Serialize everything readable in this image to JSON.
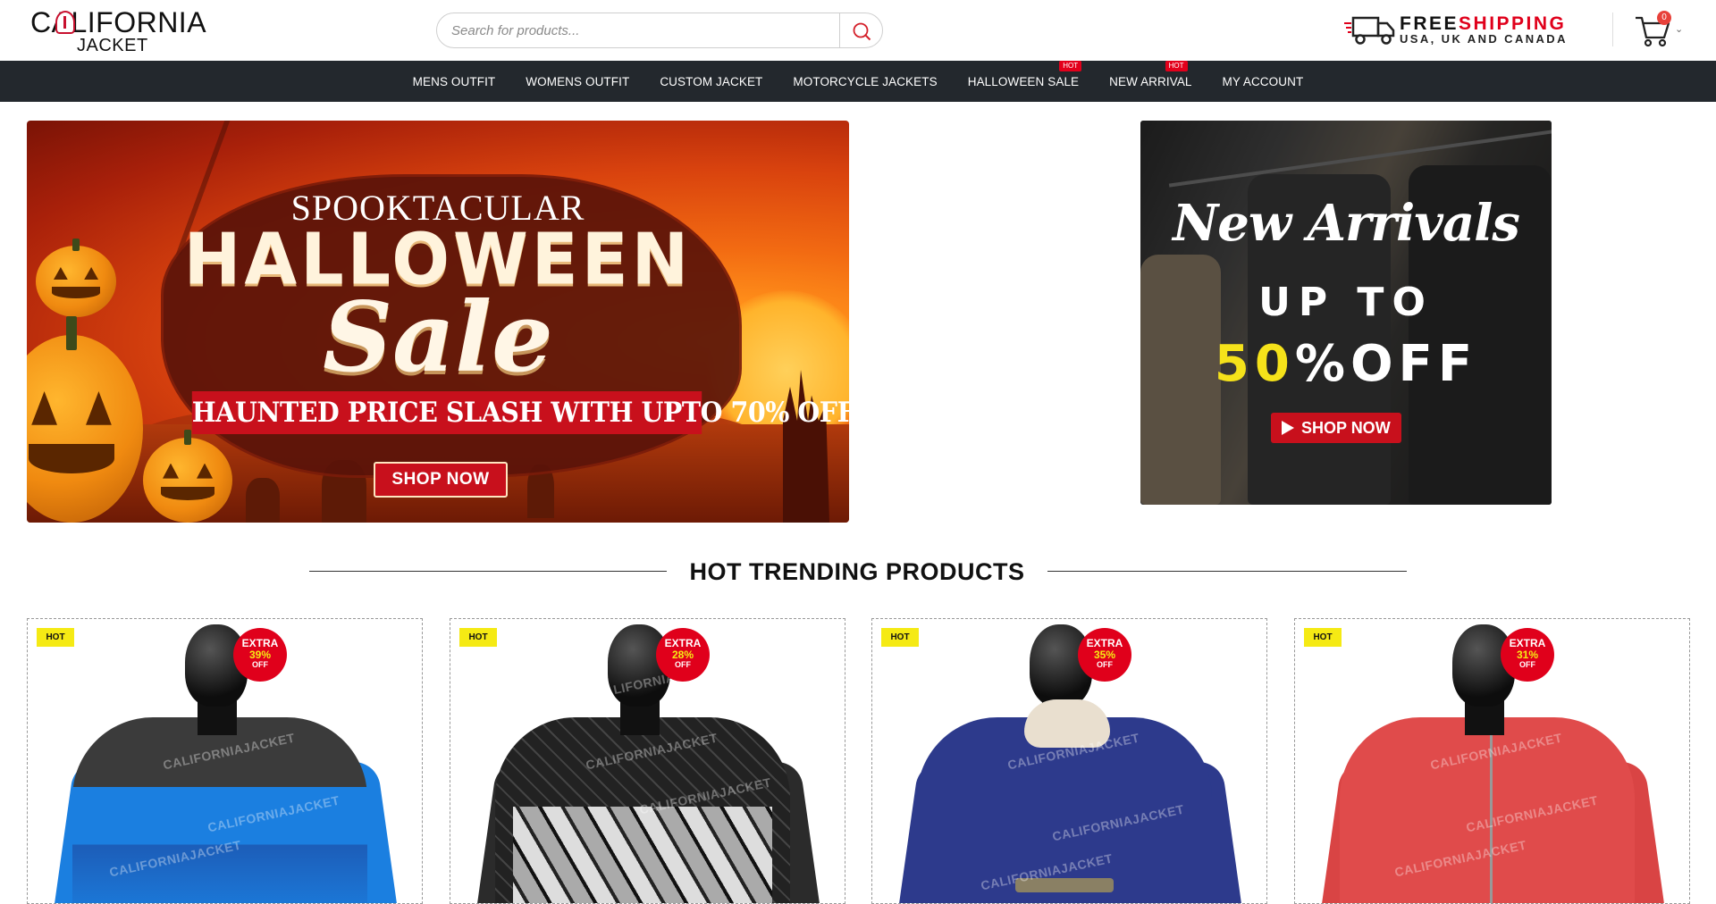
{
  "brand": {
    "logo_line1": "CALIFORNIA",
    "logo_line2": "JACKET",
    "logo_icon": "jacket-icon"
  },
  "search": {
    "placeholder": "Search for products...",
    "value": "",
    "icon": "search-icon"
  },
  "shipping": {
    "free": "FREE",
    "shipping": "SHIPPING",
    "regions": "USA, UK AND CANADA",
    "icon": "truck-icon"
  },
  "cart": {
    "count": "0",
    "icon": "cart-icon"
  },
  "nav": {
    "items": [
      {
        "label": "MENS OUTFIT"
      },
      {
        "label": "WOMENS OUTFIT"
      },
      {
        "label": "CUSTOM JACKET"
      },
      {
        "label": "MOTORCYCLE JACKETS"
      },
      {
        "label": "HALLOWEEN SALE",
        "badge": "HOT"
      },
      {
        "label": "NEW ARRIVAL",
        "badge": "HOT"
      },
      {
        "label": "MY ACCOUNT"
      }
    ]
  },
  "banner_halloween": {
    "line1": "SPOOKTACULAR",
    "line2": "HALLOWEEN",
    "line3": "Sale",
    "promo": "HAUNTED PRICE SLASH WITH UPTO 70% OFF",
    "cta": "SHOP NOW"
  },
  "banner_new": {
    "line1": "New Arrivals",
    "line2": "UP TO",
    "percent": "50",
    "off": "%OFF",
    "cta": "SHOP NOW"
  },
  "section": {
    "title": "HOT TRENDING PRODUCTS"
  },
  "products": [
    {
      "badge": "HOT",
      "extra": "EXTRA",
      "discount": "39%",
      "off": "OFF",
      "watermark": "CALIFORNIAJACKET"
    },
    {
      "badge": "HOT",
      "extra": "EXTRA",
      "discount": "28%",
      "off": "OFF",
      "watermark": "CALIFORNIAJACKET"
    },
    {
      "badge": "HOT",
      "extra": "EXTRA",
      "discount": "35%",
      "off": "OFF",
      "watermark": "CALIFORNIAJACKET"
    },
    {
      "badge": "HOT",
      "extra": "EXTRA",
      "discount": "31%",
      "off": "OFF",
      "watermark": "CALIFORNIAJACKET"
    }
  ],
  "colors": {
    "nav_bg": "#23282d",
    "accent_red": "#e0001b",
    "badge_yellow": "#f5ea14"
  }
}
